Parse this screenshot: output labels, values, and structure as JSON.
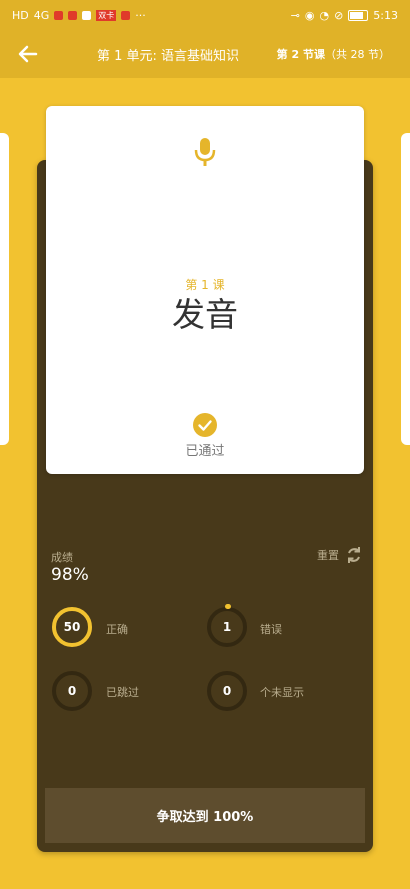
{
  "status_bar": {
    "network": "HD",
    "signal": "4G",
    "notification_badge": "双卡",
    "more": "···",
    "time": "5:13"
  },
  "header": {
    "unit_title": "第 1 单元: 语言基础知识",
    "lesson_number": "第 2 节课",
    "lesson_total": "（共 28 节）"
  },
  "card": {
    "icon": "microphone-icon",
    "lesson_label": "第 1 课",
    "lesson_name": "发音",
    "status_icon": "check-circle-icon",
    "status_label": "已通过"
  },
  "score": {
    "label": "成绩",
    "value": "98%",
    "reset_label": "重置"
  },
  "stats": [
    {
      "value": "50",
      "label": "正确",
      "progress": 1.0
    },
    {
      "value": "1",
      "label": "错误",
      "progress": 0.02
    },
    {
      "value": "0",
      "label": "已跳过",
      "progress": 0
    },
    {
      "value": "0",
      "label": "个未显示",
      "progress": 0
    }
  ],
  "goal_button": {
    "label": "争取达到 100%"
  },
  "colors": {
    "accent": "#f2c230",
    "panel": "#48391a",
    "card": "#ffffff"
  }
}
